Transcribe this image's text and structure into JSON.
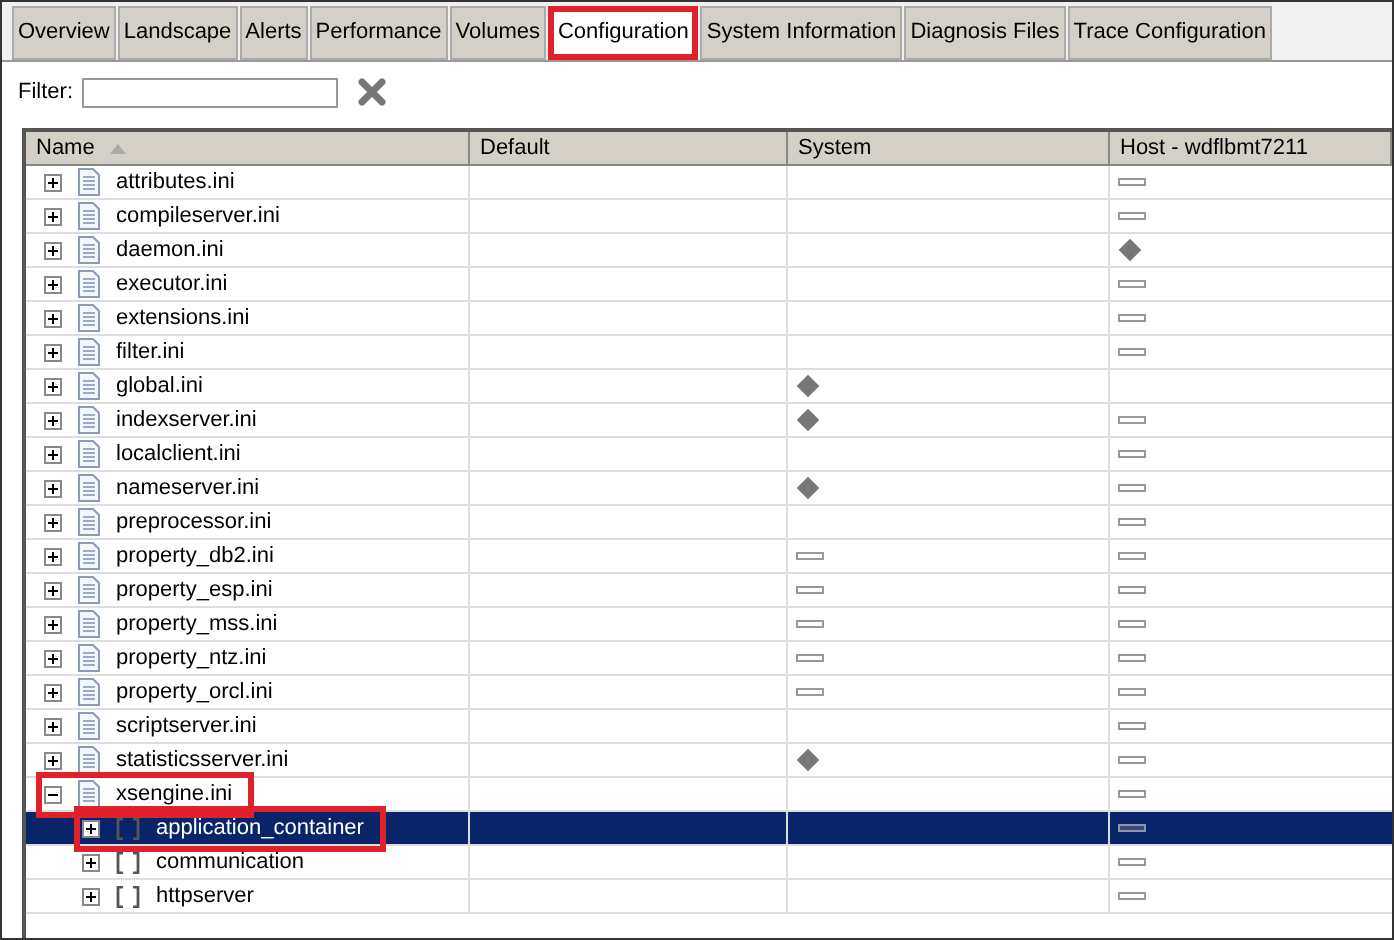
{
  "tabs": [
    {
      "label": "Overview",
      "selected": false,
      "highlighted": false
    },
    {
      "label": "Landscape",
      "selected": false,
      "highlighted": false
    },
    {
      "label": "Alerts",
      "selected": false,
      "highlighted": false
    },
    {
      "label": "Performance",
      "selected": false,
      "highlighted": false
    },
    {
      "label": "Volumes",
      "selected": false,
      "highlighted": false
    },
    {
      "label": "Configuration",
      "selected": true,
      "highlighted": true
    },
    {
      "label": "System Information",
      "selected": false,
      "highlighted": false
    },
    {
      "label": "Diagnosis Files",
      "selected": false,
      "highlighted": false
    },
    {
      "label": "Trace Configuration",
      "selected": false,
      "highlighted": false
    }
  ],
  "filter": {
    "label": "Filter:"
  },
  "table": {
    "columns": [
      "Name",
      "Default",
      "System",
      "Host - wdflbmt7211"
    ],
    "rows": [
      {
        "name": "attributes.ini",
        "kind": "file",
        "expanded": false,
        "selected": false,
        "highlighted": false,
        "host": {
          "kind": "dash"
        }
      },
      {
        "name": "compileserver.ini",
        "kind": "file",
        "expanded": false,
        "selected": false,
        "highlighted": false,
        "host": {
          "kind": "dash"
        }
      },
      {
        "name": "daemon.ini",
        "kind": "file",
        "expanded": false,
        "selected": false,
        "highlighted": false,
        "host": {
          "kind": "diamond"
        }
      },
      {
        "name": "executor.ini",
        "kind": "file",
        "expanded": false,
        "selected": false,
        "highlighted": false,
        "host": {
          "kind": "dash"
        }
      },
      {
        "name": "extensions.ini",
        "kind": "file",
        "expanded": false,
        "selected": false,
        "highlighted": false,
        "host": {
          "kind": "dash"
        }
      },
      {
        "name": "filter.ini",
        "kind": "file",
        "expanded": false,
        "selected": false,
        "highlighted": false,
        "host": {
          "kind": "dash"
        }
      },
      {
        "name": "global.ini",
        "kind": "file",
        "expanded": false,
        "selected": false,
        "highlighted": false,
        "system": {
          "kind": "diamond"
        }
      },
      {
        "name": "indexserver.ini",
        "kind": "file",
        "expanded": false,
        "selected": false,
        "highlighted": false,
        "system": {
          "kind": "diamond"
        },
        "host": {
          "kind": "dash"
        }
      },
      {
        "name": "localclient.ini",
        "kind": "file",
        "expanded": false,
        "selected": false,
        "highlighted": false,
        "host": {
          "kind": "dash"
        }
      },
      {
        "name": "nameserver.ini",
        "kind": "file",
        "expanded": false,
        "selected": false,
        "highlighted": false,
        "system": {
          "kind": "diamond"
        },
        "host": {
          "kind": "dash"
        }
      },
      {
        "name": "preprocessor.ini",
        "kind": "file",
        "expanded": false,
        "selected": false,
        "highlighted": false,
        "host": {
          "kind": "dash"
        }
      },
      {
        "name": "property_db2.ini",
        "kind": "file",
        "expanded": false,
        "selected": false,
        "highlighted": false,
        "system": {
          "kind": "dash"
        },
        "host": {
          "kind": "dash"
        }
      },
      {
        "name": "property_esp.ini",
        "kind": "file",
        "expanded": false,
        "selected": false,
        "highlighted": false,
        "system": {
          "kind": "dash"
        },
        "host": {
          "kind": "dash"
        }
      },
      {
        "name": "property_mss.ini",
        "kind": "file",
        "expanded": false,
        "selected": false,
        "highlighted": false,
        "system": {
          "kind": "dash"
        },
        "host": {
          "kind": "dash"
        }
      },
      {
        "name": "property_ntz.ini",
        "kind": "file",
        "expanded": false,
        "selected": false,
        "highlighted": false,
        "system": {
          "kind": "dash"
        },
        "host": {
          "kind": "dash"
        }
      },
      {
        "name": "property_orcl.ini",
        "kind": "file",
        "expanded": false,
        "selected": false,
        "highlighted": false,
        "system": {
          "kind": "dash"
        },
        "host": {
          "kind": "dash"
        }
      },
      {
        "name": "scriptserver.ini",
        "kind": "file",
        "expanded": false,
        "selected": false,
        "highlighted": false,
        "host": {
          "kind": "dash"
        }
      },
      {
        "name": "statisticsserver.ini",
        "kind": "file",
        "expanded": false,
        "selected": false,
        "highlighted": false,
        "system": {
          "kind": "diamond"
        },
        "host": {
          "kind": "dash"
        }
      },
      {
        "name": "xsengine.ini",
        "kind": "file",
        "expanded": true,
        "selected": false,
        "highlighted": true,
        "host": {
          "kind": "dash"
        },
        "children": [
          {
            "name": "application_container",
            "kind": "section",
            "expanded": false,
            "selected": true,
            "highlighted": true,
            "host": {
              "kind": "dash"
            }
          },
          {
            "name": "communication",
            "kind": "section",
            "expanded": false,
            "selected": false,
            "highlighted": false,
            "host": {
              "kind": "dash"
            }
          },
          {
            "name": "httpserver",
            "kind": "section",
            "expanded": false,
            "selected": false,
            "highlighted": false,
            "host": {
              "kind": "dash"
            }
          }
        ]
      }
    ]
  }
}
